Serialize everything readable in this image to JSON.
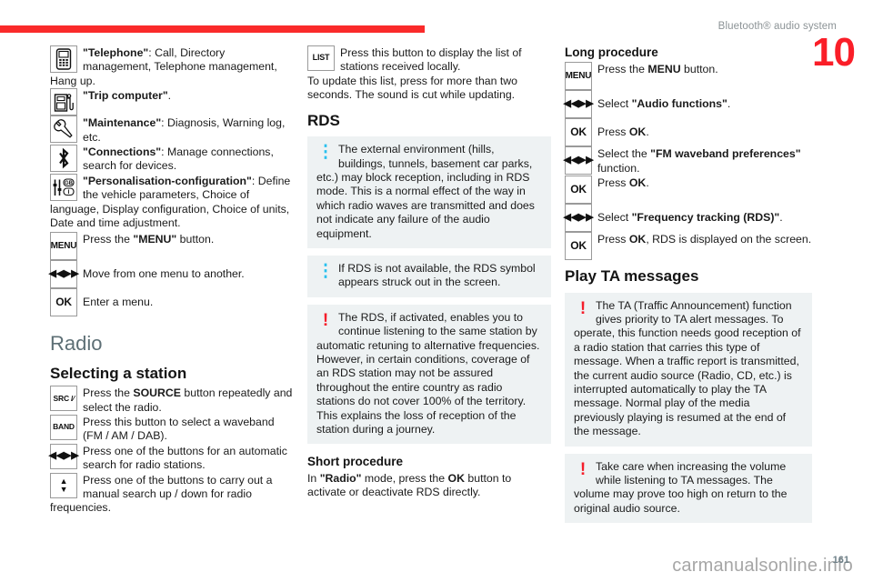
{
  "header": {
    "title": "Bluetooth® audio system",
    "chapter_number": "10",
    "rule_color": "#fa2a2a"
  },
  "colors": {
    "accent_red": "#fa1e28",
    "section_heading": "#5d6f75",
    "note_background": "#eef2f3",
    "info_glyph": "#29c0ee",
    "warn_glyph": "#f51d2a"
  },
  "column1": {
    "menu_items": [
      {
        "icon": "telephone-icon",
        "key_label": "",
        "text_html": "<b>\"Telephone\"</b>: Call, Directory management, Telephone management,"
      },
      {
        "icon": "trip-computer-icon",
        "key_label": "",
        "text_html": "<b>\"Trip computer\"</b>."
      },
      {
        "icon": "maintenance-wrench-icon",
        "key_label": "",
        "text_html": "<b>\"Maintenance\"</b>: Diagnosis, Warning log, etc."
      },
      {
        "icon": "bluetooth-icon",
        "key_label": "",
        "text_html": "<b>\"Connections\"</b>: Manage connections, search for devices."
      },
      {
        "icon": "personalisation-configuration-icon",
        "key_label": "",
        "text_html": "<b>\"Personalisation-configuration\"</b>: Define the vehicle parameters, Choice of"
      }
    ],
    "hangup_runon": "Hang up.",
    "personalisation_runon": "language, Display configuration, Choice of units, Date and time adjustment.",
    "key_rows": [
      {
        "key": "MENU",
        "text_html": "Press the <b>\"MENU\"</b> button."
      },
      {
        "key": "◀◀▶▶",
        "text_html": "Move from one menu to another."
      },
      {
        "key": "OK",
        "text_html": "Enter a menu."
      }
    ],
    "radio_heading": "Radio",
    "selecting_heading": "Selecting a station",
    "radio_key_rows": [
      {
        "key": "SRC /∕",
        "text_html": "Press the <b>SOURCE</b> button repeatedly and select the radio."
      },
      {
        "key": "BAND",
        "text_html": "Press this button to select a waveband (FM / AM / DAB)."
      },
      {
        "key": "◀◀▶▶",
        "text_html": "Press one of the buttons for an automatic search for radio stations."
      },
      {
        "key": "▲▼",
        "text_html": "Press one of the buttons to carry out a manual search up / down for radio"
      }
    ],
    "frequencies_runon": "frequencies."
  },
  "column2": {
    "list_row": {
      "key": "LIST",
      "text_html": "Press this button to display the list of stations received locally."
    },
    "list_runon": "To update this list, press for more than two seconds. The sound is cut while updating.",
    "rds_heading": "RDS",
    "notes": [
      {
        "type": "info",
        "glyph": "info-icon",
        "text_html": "The external environment (hills, buildings, tunnels, basement car parks, etc.) may block reception, including in RDS mode. This is a normal effect of the way in which radio waves are transmitted and does not indicate any failure of the audio equipment."
      },
      {
        "type": "info",
        "glyph": "info-icon",
        "text_html": "If RDS is not available, the RDS symbol appears struck out in the screen."
      },
      {
        "type": "warn",
        "glyph": "warning-icon",
        "text_html": "The RDS, if activated, enables you to continue listening to the same station by automatic retuning to alternative frequencies. However, in certain conditions, coverage of an RDS station may not be assured throughout the entire country as radio stations do not cover 100% of the territory. This explains the loss of reception of the station during a journey."
      }
    ],
    "short_procedure_heading": "Short procedure",
    "short_procedure_text_html": "In <b>\"Radio\"</b> mode, press the <b>OK</b> button to activate or deactivate RDS directly."
  },
  "column3": {
    "long_procedure_heading": "Long procedure",
    "key_rows": [
      {
        "key": "MENU",
        "text_html": "Press the <b>MENU</b> button."
      },
      {
        "key": "◀◀▶▶",
        "text_html": "Select <b>\"Audio functions\"</b>."
      },
      {
        "key": "OK",
        "text_html": "Press <b>OK</b>."
      },
      {
        "key": "◀◀▶▶",
        "text_html": "Select the <b>\"FM waveband preferences\"</b> function."
      },
      {
        "key": "OK",
        "text_html": "Press <b>OK</b>."
      },
      {
        "key": "◀◀▶▶",
        "text_html": "Select <b>\"Frequency tracking (RDS)\"</b>."
      },
      {
        "key": "OK",
        "text_html": "Press <b>OK</b>, RDS is displayed on the screen."
      }
    ],
    "play_ta_heading": "Play TA messages",
    "notes": [
      {
        "type": "warn",
        "glyph": "warning-icon",
        "text_html": "The TA (Traffic Announcement) function gives priority to TA alert messages. To operate, this function needs good reception of a radio station that carries this type of message. When a traffic report is transmitted, the current audio source (Radio, CD, etc.) is interrupted automatically to play the TA message. Normal play of the media previously playing is resumed at the end of the message."
      },
      {
        "type": "warn",
        "glyph": "warning-icon",
        "text_html": "Take care when increasing the volume while listening to TA messages. The volume may prove too high on return to the original audio source."
      }
    ]
  },
  "footer": {
    "watermark": "carmanualsonline.info",
    "page_number": "161"
  }
}
